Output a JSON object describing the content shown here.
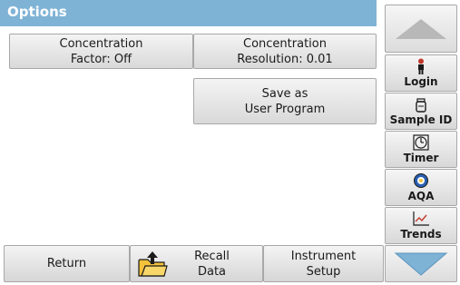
{
  "title": "Options",
  "main_buttons": {
    "concentration_factor": "Concentration\nFactor: Off",
    "concentration_resolution": "Concentration\nResolution: 0.01",
    "save_user_program": "Save as\nUser Program"
  },
  "sidebar": {
    "login": "Login",
    "sample_id": "Sample ID",
    "timer": "Timer",
    "aqa": "AQA",
    "trends": "Trends"
  },
  "bottom_bar": {
    "return": "Return",
    "recall_data": "Recall\nData",
    "instrument_setup": "Instrument\nSetup"
  },
  "icons": {
    "up": "up-arrow-icon",
    "down": "down-arrow-icon",
    "login": "person-icon",
    "sample_id": "sample-bottle-icon",
    "timer": "timer-icon",
    "aqa": "aqa-icon",
    "trends": "trends-chart-icon",
    "recall": "folder-upload-icon"
  },
  "colors": {
    "title_bar": "#7fb3d6",
    "arrow": "#7fb3d6",
    "aqa_accent": "#2a5fb0",
    "trend_line": "#c0392b",
    "folder": "#f2c23a"
  }
}
